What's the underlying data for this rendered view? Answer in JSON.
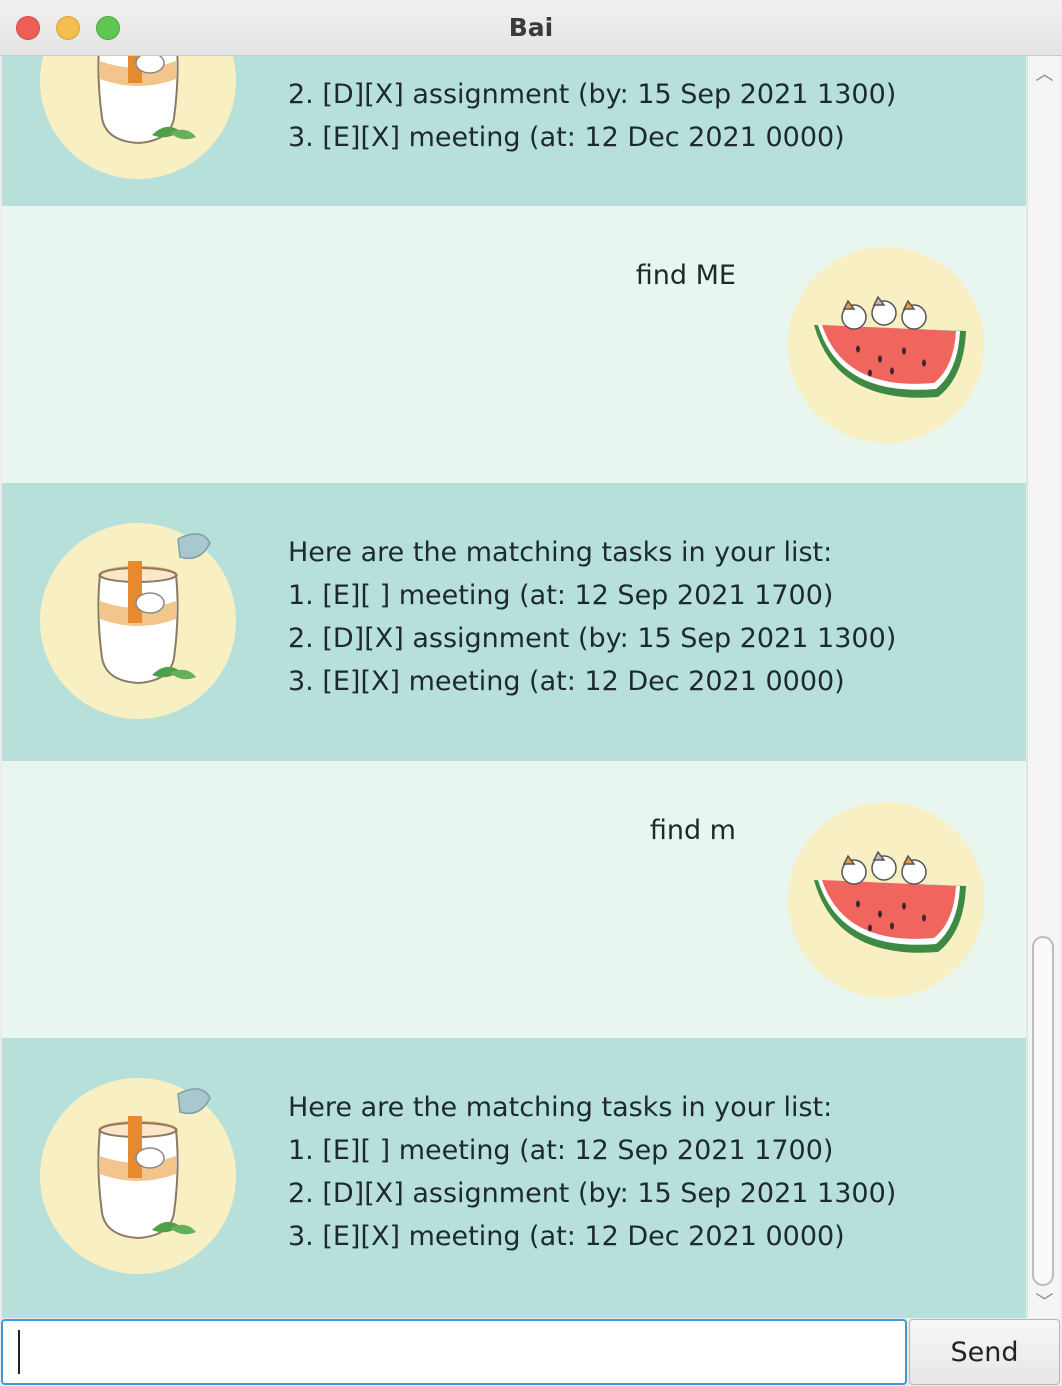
{
  "window": {
    "title": "Bai"
  },
  "messages": [
    {
      "sender": "bot",
      "avatar": "jar-cat-icon",
      "lines": [
        "2. [D][X] assignment (by: 15 Sep 2021 1300)",
        "3. [E][X] meeting (at: 12 Dec 2021 0000)"
      ]
    },
    {
      "sender": "user",
      "avatar": "watermelon-cats-icon",
      "lines": [
        "find ME"
      ]
    },
    {
      "sender": "bot",
      "avatar": "jar-cat-icon",
      "lines": [
        "Here are the matching tasks in your list:",
        "1. [E][ ] meeting (at: 12 Sep 2021 1700)",
        "2. [D][X] assignment (by: 15 Sep 2021 1300)",
        "3. [E][X] meeting (at: 12 Dec 2021 0000)"
      ]
    },
    {
      "sender": "user",
      "avatar": "watermelon-cats-icon",
      "lines": [
        "find m"
      ]
    },
    {
      "sender": "bot",
      "avatar": "jar-cat-icon",
      "lines": [
        "Here are the matching tasks in your list:",
        "1. [E][ ] meeting (at: 12 Sep 2021 1700)",
        "2. [D][X] assignment (by: 15 Sep 2021 1300)",
        "3. [E][X] meeting (at: 12 Dec 2021 0000)"
      ]
    }
  ],
  "input": {
    "value": "",
    "placeholder": ""
  },
  "send_button": {
    "label": "Send"
  },
  "colors": {
    "bot_bg": "#b7e0da",
    "user_bg": "#e9f5ef",
    "avatar_bg": "#f8efc3",
    "focus": "#3a9bd9"
  }
}
